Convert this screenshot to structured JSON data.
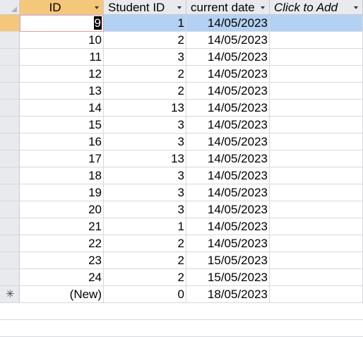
{
  "columns": [
    {
      "label": "ID"
    },
    {
      "label": "Student ID"
    },
    {
      "label": "current date"
    },
    {
      "label": "Click to Add"
    }
  ],
  "rows": [
    {
      "id": "9",
      "student_id": "1",
      "date": "14/05/2023"
    },
    {
      "id": "10",
      "student_id": "2",
      "date": "14/05/2023"
    },
    {
      "id": "11",
      "student_id": "3",
      "date": "14/05/2023"
    },
    {
      "id": "12",
      "student_id": "2",
      "date": "14/05/2023"
    },
    {
      "id": "13",
      "student_id": "2",
      "date": "14/05/2023"
    },
    {
      "id": "14",
      "student_id": "13",
      "date": "14/05/2023"
    },
    {
      "id": "15",
      "student_id": "3",
      "date": "14/05/2023"
    },
    {
      "id": "16",
      "student_id": "3",
      "date": "14/05/2023"
    },
    {
      "id": "17",
      "student_id": "13",
      "date": "14/05/2023"
    },
    {
      "id": "18",
      "student_id": "3",
      "date": "14/05/2023"
    },
    {
      "id": "19",
      "student_id": "3",
      "date": "14/05/2023"
    },
    {
      "id": "20",
      "student_id": "3",
      "date": "14/05/2023"
    },
    {
      "id": "21",
      "student_id": "1",
      "date": "14/05/2023"
    },
    {
      "id": "22",
      "student_id": "2",
      "date": "14/05/2023"
    },
    {
      "id": "23",
      "student_id": "2",
      "date": "15/05/2023"
    },
    {
      "id": "24",
      "student_id": "2",
      "date": "15/05/2023"
    }
  ],
  "new_row": {
    "id": "(New)",
    "student_id": "0",
    "date": "18/05/2023",
    "marker": "✳"
  },
  "colors": {
    "header_bg": "#e9eaee",
    "selected_header_bg": "#f5c77a",
    "row_highlight": "#b3d2f3"
  }
}
